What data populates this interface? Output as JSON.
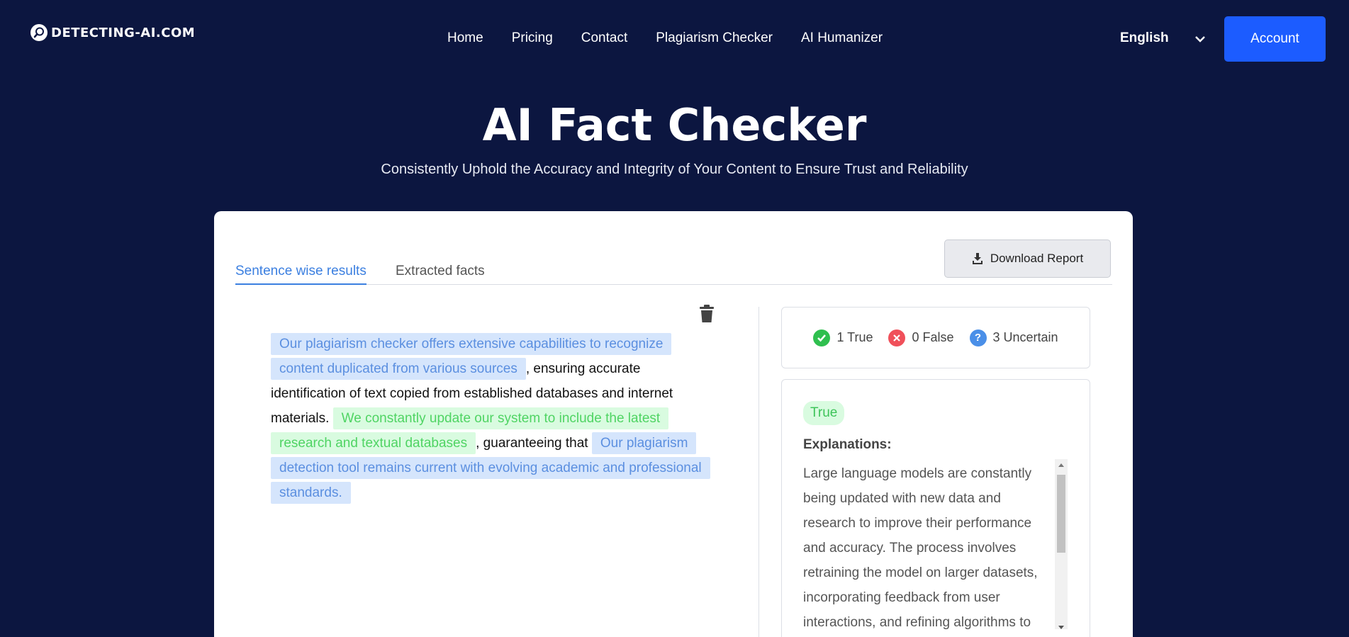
{
  "header": {
    "logo_text": "DETECTING-AI.COM",
    "nav": [
      "Home",
      "Pricing",
      "Contact",
      "Plagiarism Checker",
      "AI Humanizer"
    ],
    "language": "English",
    "account_label": "Account"
  },
  "hero": {
    "title": "AI Fact Checker",
    "subtitle": "Consistently Uphold the Accuracy and Integrity of Your Content to Ensure Trust and Reliability"
  },
  "tabs": {
    "sentence_wise": "Sentence wise results",
    "extracted_facts": "Extracted facts",
    "active": "sentence_wise"
  },
  "toolbar": {
    "download_label": "Download Report"
  },
  "content": {
    "segments": [
      {
        "text": "Our plagiarism checker offers extensive capabilities to recognize content duplicated from various sources",
        "status": "uncertain"
      },
      {
        "text": ", ensuring accurate identification of text copied from established databases and internet materials. ",
        "status": "none"
      },
      {
        "text": "We constantly update our system to include the latest research and textual databases",
        "status": "true"
      },
      {
        "text": ", guaranteeing that ",
        "status": "none"
      },
      {
        "text": "Our plagiarism detection tool remains current with evolving academic and professional standards.",
        "status": "uncertain"
      }
    ]
  },
  "summary": {
    "true_label": "1 True",
    "false_label": "0 False",
    "uncertain_label": "3 Uncertain"
  },
  "detail": {
    "verdict": "True",
    "explanations_label": "Explanations:",
    "explanation_text": "Large language models are constantly being updated with new data and research to improve their performance and accuracy. The process involves retraining the model on larger datasets, incorporating feedback from user interactions, and refining algorithms to"
  },
  "colors": {
    "background": "#0c1640",
    "accent": "#1c5cff",
    "tab_active": "#3b7fe0",
    "true_green": "#4fd463",
    "false_red": "#f0505a",
    "uncertain_blue": "#5b8fe0"
  }
}
